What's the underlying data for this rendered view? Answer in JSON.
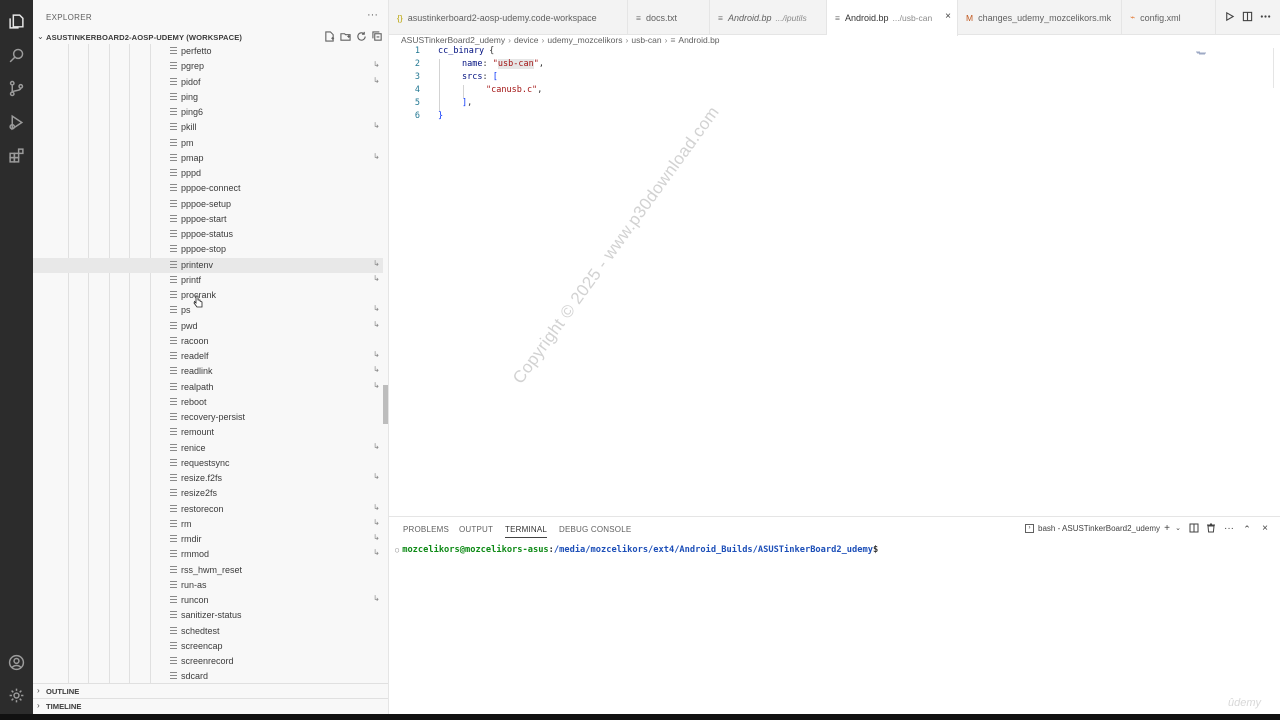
{
  "activity_bar": {
    "icons": [
      "explorer-icon",
      "search-icon",
      "source-control-icon",
      "run-debug-icon",
      "extensions-icon",
      "account-icon",
      "settings-gear-icon"
    ]
  },
  "sidebar": {
    "title": "EXPLORER",
    "more": "···",
    "workspace_title": "ASUSTINKERBOARD2-AOSP-UDEMY (WORKSPACE)",
    "files": [
      {
        "name": "perfetto",
        "link": false
      },
      {
        "name": "pgrep",
        "link": true
      },
      {
        "name": "pidof",
        "link": true
      },
      {
        "name": "ping",
        "link": false
      },
      {
        "name": "ping6",
        "link": false
      },
      {
        "name": "pkill",
        "link": true
      },
      {
        "name": "pm",
        "link": false
      },
      {
        "name": "pmap",
        "link": true
      },
      {
        "name": "pppd",
        "link": false
      },
      {
        "name": "pppoe-connect",
        "link": false
      },
      {
        "name": "pppoe-setup",
        "link": false
      },
      {
        "name": "pppoe-start",
        "link": false
      },
      {
        "name": "pppoe-status",
        "link": false
      },
      {
        "name": "pppoe-stop",
        "link": false
      },
      {
        "name": "printenv",
        "link": true
      },
      {
        "name": "printf",
        "link": true
      },
      {
        "name": "procrank",
        "link": false
      },
      {
        "name": "ps",
        "link": true
      },
      {
        "name": "pwd",
        "link": true
      },
      {
        "name": "racoon",
        "link": false
      },
      {
        "name": "readelf",
        "link": true
      },
      {
        "name": "readlink",
        "link": true
      },
      {
        "name": "realpath",
        "link": true
      },
      {
        "name": "reboot",
        "link": false
      },
      {
        "name": "recovery-persist",
        "link": false
      },
      {
        "name": "remount",
        "link": false
      },
      {
        "name": "renice",
        "link": true
      },
      {
        "name": "requestsync",
        "link": false
      },
      {
        "name": "resize.f2fs",
        "link": true
      },
      {
        "name": "resize2fs",
        "link": false
      },
      {
        "name": "restorecon",
        "link": true
      },
      {
        "name": "rm",
        "link": true
      },
      {
        "name": "rmdir",
        "link": true
      },
      {
        "name": "rmmod",
        "link": true
      },
      {
        "name": "rss_hwm_reset",
        "link": false
      },
      {
        "name": "run-as",
        "link": false
      },
      {
        "name": "runcon",
        "link": true
      },
      {
        "name": "sanitizer-status",
        "link": false
      },
      {
        "name": "schedtest",
        "link": false
      },
      {
        "name": "screencap",
        "link": false
      },
      {
        "name": "screenrecord",
        "link": false
      },
      {
        "name": "sdcard",
        "link": false
      }
    ],
    "link_glyph": "↳",
    "outline_label": "OUTLINE",
    "timeline_label": "TIMELINE"
  },
  "tabs": [
    {
      "icon": "{}",
      "label": "asustinkerboard2-aosp-udemy.code-workspace",
      "sub": "",
      "italic": false,
      "active": false
    },
    {
      "icon": "≡",
      "label": "docs.txt",
      "sub": "",
      "italic": false,
      "active": false
    },
    {
      "icon": "≡",
      "label": "Android.bp",
      "sub": ".../iputils",
      "italic": true,
      "active": false
    },
    {
      "icon": "≡",
      "label": "Android.bp",
      "sub": ".../usb-can",
      "italic": false,
      "active": true
    },
    {
      "icon": "M",
      "label": "changes_udemy_mozcelikors.mk",
      "sub": "",
      "italic": false,
      "active": false
    },
    {
      "icon": "⌁",
      "label": "config.xml",
      "sub": "",
      "italic": false,
      "active": false
    }
  ],
  "tab_close": "×",
  "breadcrumb": [
    "ASUSTinkerBoard2_udemy",
    "device",
    "udemy_mozcelikors",
    "usb-can",
    "Android.bp"
  ],
  "breadcrumb_sep": "›",
  "editor": {
    "line_numbers": [
      "1",
      "2",
      "3",
      "4",
      "5",
      "6"
    ],
    "lines": {
      "l1_kw": "cc_binary",
      "l1_rest": " {",
      "l2_key": "name",
      "l2_colon": ": ",
      "l2_q1": "\"",
      "l2_val": "usb-can",
      "l2_q2": "\"",
      "l2_end": ",",
      "l3_key": "srcs",
      "l3_colon": ": ",
      "l3_br": "[",
      "l4_val": "\"canusb.c\"",
      "l4_end": ",",
      "l5_br": "]",
      "l5_end": ",",
      "l6": "}"
    },
    "watermark": "Copyright © 2025 - www.p30download.com"
  },
  "panel": {
    "tabs": [
      "PROBLEMS",
      "OUTPUT",
      "TERMINAL",
      "DEBUG CONSOLE"
    ],
    "active_tab": "TERMINAL",
    "terminal_name": "bash - ASUSTinkerBoard2_udemy",
    "prompt_dot": "○",
    "prompt_user": "mozcelikors@mozcelikors-asus",
    "prompt_colon": ":",
    "prompt_path": "/media/mozcelikors/ext4/Android_Builds/ASUSTinkerBoard2_udemy",
    "prompt_sign": "$"
  },
  "udemy_watermark": "ûdemy",
  "colors": {
    "activity_bar": "#2c2c2c",
    "sidebar": "#f8f8f8",
    "keyword": "#001080",
    "string": "#a31515",
    "bracket": "#0431fa",
    "line_number": "#237893",
    "prompt_user": "#0e8a16",
    "prompt_path": "#1d4fb8"
  }
}
